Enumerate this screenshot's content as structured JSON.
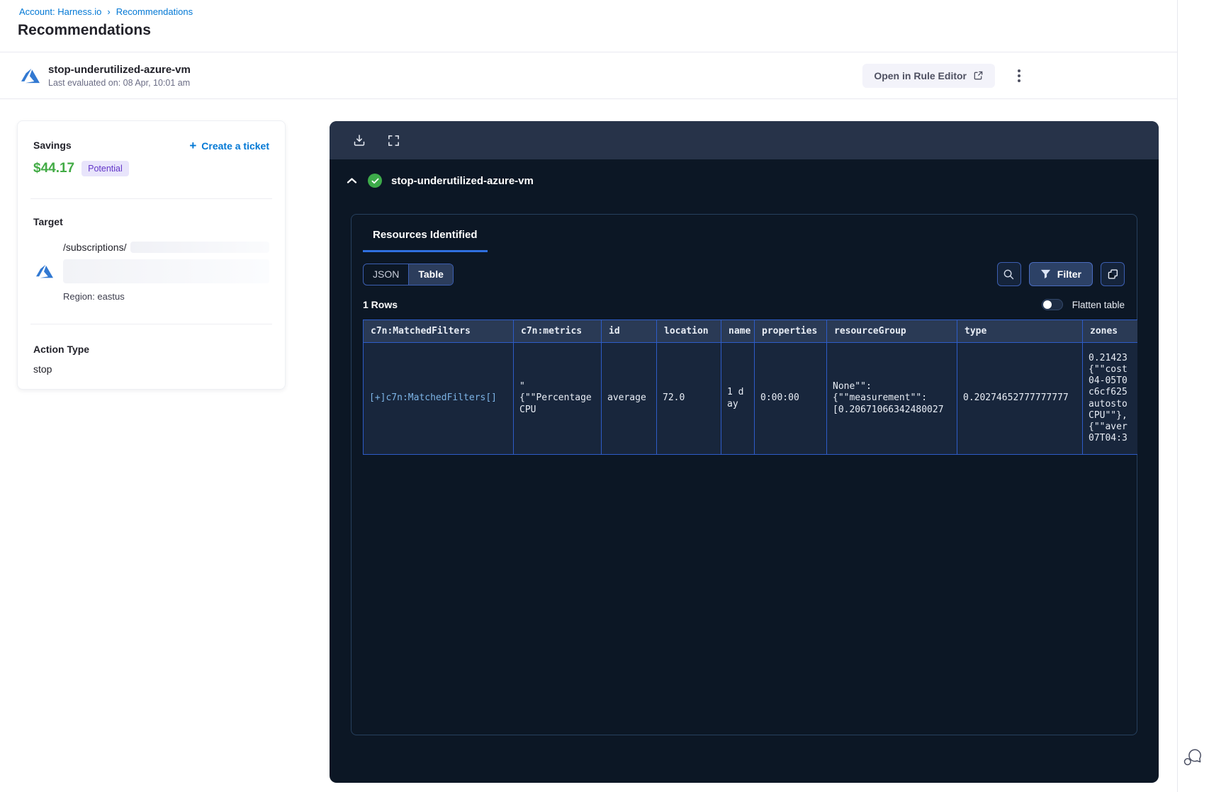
{
  "breadcrumb": {
    "account_label": "Account: Harness.io",
    "separator": "›",
    "page_label": "Recommendations"
  },
  "page_title": "Recommendations",
  "recommendation_header": {
    "title": "stop-underutilized-azure-vm",
    "subtitle": "Last evaluated on: 08 Apr, 10:01 am",
    "open_rule_editor_label": "Open in Rule Editor"
  },
  "details_card": {
    "savings_label": "Savings",
    "savings_amount": "$44.17",
    "savings_badge": "Potential",
    "create_ticket_plus": "+",
    "create_ticket_label": "Create a ticket",
    "target_label": "Target",
    "target_path": "/subscriptions/",
    "target_region": "Region: eastus",
    "action_type_label": "Action Type",
    "action_type_value": "stop"
  },
  "results_panel": {
    "title": "stop-underutilized-azure-vm",
    "tab_label": "Resources Identified",
    "view_json_label": "JSON",
    "view_table_label": "Table",
    "selected_view": "Table",
    "filter_label": "Filter",
    "rows_count": "1 Rows",
    "flatten_label": "Flatten table",
    "table": {
      "columns": [
        "c7n:MatchedFilters",
        "c7n:metrics",
        "id",
        "location",
        "name",
        "properties",
        "resourceGroup",
        "type",
        "zones"
      ],
      "row": {
        "matched_filters": "[+]c7n:MatchedFilters[]",
        "metrics": "\"\n{\"\"Percentage\nCPU",
        "id": "average",
        "location": "72.0",
        "name": "1 day",
        "properties": "0:00:00",
        "resource_group": "None\"\":\n{\"\"measurement\"\":\n[0.20671066342480027",
        "type": "0.20274652777777777",
        "zones": "0.21423\n{\"\"cost\n04-05T0\nc6cf625\nautosto\nCPU\"\"},\n{\"\"aver\n07T04:3"
      }
    }
  },
  "icons": {
    "provider": "azure-icon",
    "status": "check-circle-icon"
  },
  "colors": {
    "accent_blue": "#0278d5",
    "savings_green": "#42ab45",
    "badge_purple_bg": "#e8e4fb",
    "badge_purple_text": "#6236c8",
    "panel_bg": "#0c1725",
    "panel_toolbar_bg": "#273349",
    "table_border": "#2d5cc8",
    "tab_underline": "#2f6fe0",
    "check_green": "#3dab4a"
  }
}
